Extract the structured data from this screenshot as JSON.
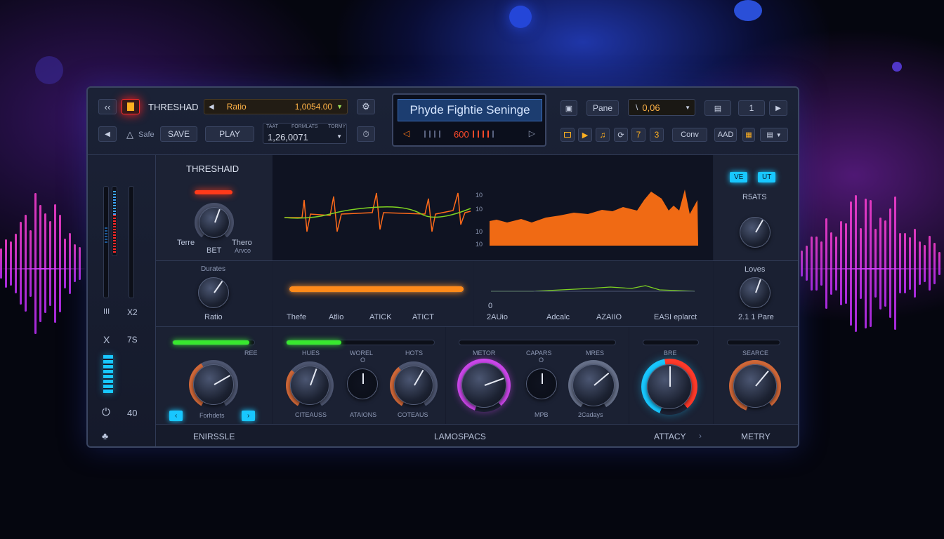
{
  "toolbar": {
    "back_icon": "double-chevron-left-icon",
    "plugin_label": "THRESHAD",
    "ratio_label": "Ratio",
    "ratio_value": "1,0054.00",
    "settings_icon": "gear-icon",
    "preset_label": "Safe",
    "save_label": "SAVE",
    "play_label": "PLAY",
    "mini_headers": [
      "TAAT",
      "FORMLATS",
      "TORMY"
    ],
    "counter_value": "1,26,0071",
    "timer_icon": "stopwatch-icon"
  },
  "display": {
    "title": "Phyde Fightie Seninge",
    "value": "600"
  },
  "right_toolbar": {
    "pane_label": "Pane",
    "value_field": "0,06",
    "page_number": "1",
    "toggle_seven": "7",
    "toggle_three": "3",
    "conv_label": "Conv",
    "add_label": "AAD"
  },
  "left_strip": {
    "label_ii": "III",
    "label_x2": "X2",
    "label_x": "X",
    "label_7s": "7S",
    "label_40": "40"
  },
  "threshold": {
    "title": "THRESHAID",
    "left_label": "Terre",
    "center_label": "BET",
    "right_label": "Thero",
    "right_sub": "Arvco"
  },
  "graph": {
    "tick_labels": [
      "10",
      "10",
      "10",
      "10"
    ]
  },
  "right_top": {
    "chip1": "VE",
    "chip2": "UT",
    "label": "R5ATS"
  },
  "row2": {
    "knob_title": "Durates",
    "knob_label": "Ratio",
    "bar_labels": [
      "Thefe",
      "Atlio",
      "ATICK",
      "ATICT"
    ],
    "scale_labels": [
      "0",
      "2AUio",
      "Adcalc",
      "AZAIIO",
      "EASI eplarct"
    ],
    "right_title": "Loves",
    "right_label": "2.1 1 Pare"
  },
  "row3": {
    "col1_label": "REE",
    "col1_bottom": "Forhdets",
    "col2_labels": [
      "HUES",
      "WOREL",
      "HOTS"
    ],
    "col2_bottom": [
      "CITEAUSS",
      "ATAIONS",
      "COTEAUS"
    ],
    "col2_mid_small": "O",
    "col3_labels": [
      "METOR",
      "CAPARS",
      "MRES"
    ],
    "col3_bottom": [
      "MPB",
      "2Cadays"
    ],
    "col3_mid_small": "O",
    "col4_label": "BRE",
    "col5_label": "SEARCE"
  },
  "footer": {
    "section1": "ENIRSSLE",
    "section2": "LAMOSPACS",
    "section3": "ATTACY",
    "section4": "METRY"
  },
  "colors": {
    "accent_orange": "#ff7a1a",
    "accent_green": "#38e82f",
    "accent_cyan": "#18c7ff",
    "accent_red": "#ff3020"
  }
}
